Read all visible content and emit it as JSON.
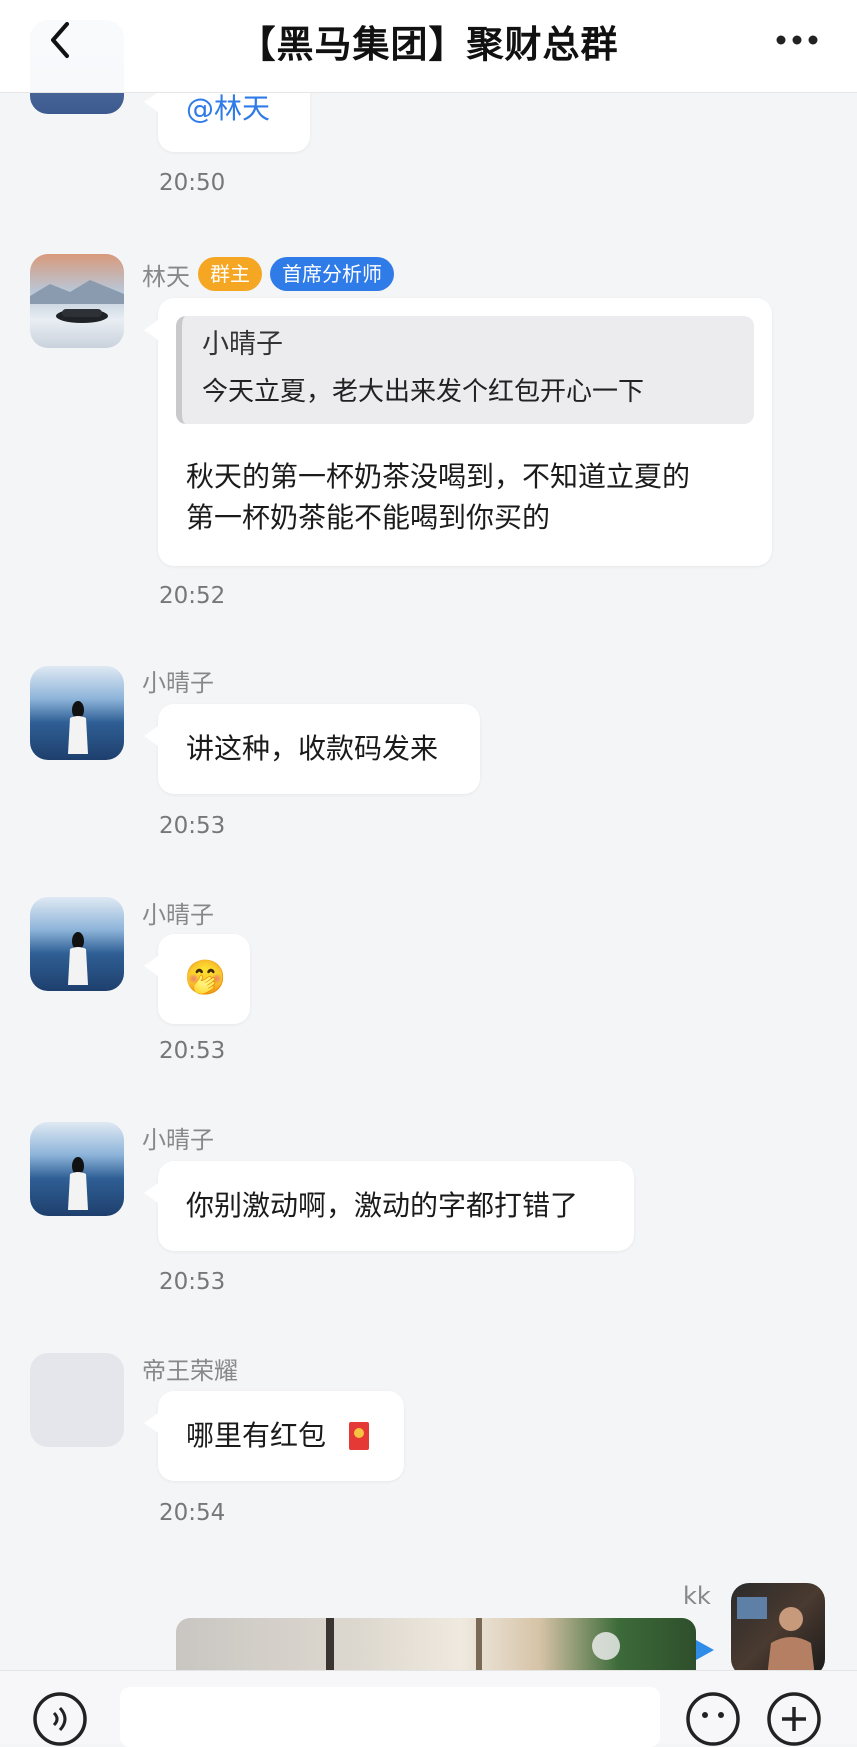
{
  "header": {
    "title": "【黑马集团】聚财总群"
  },
  "messages": [
    {
      "text": "@林天",
      "time": "20:50"
    },
    {
      "sender": "林天",
      "badges": {
        "owner": "群主",
        "title": "首席分析师"
      },
      "quote": {
        "author": "小晴子",
        "text": "今天立夏，老大出来发个红包开心一下"
      },
      "line1": "秋天的第一杯奶茶没喝到，不知道立夏的",
      "line2": "第一杯奶茶能不能喝到你买的",
      "time": "20:52"
    },
    {
      "sender": "小晴子",
      "text": "讲这种，收款码发来",
      "time": "20:53"
    },
    {
      "sender": "小晴子",
      "emoji": "🤭",
      "time": "20:53"
    },
    {
      "sender": "小晴子",
      "text": "你别激动啊，激动的字都打错了",
      "time": "20:53"
    },
    {
      "sender": "帝王荣耀",
      "text": "哪里有红包",
      "time": "20:54"
    },
    {
      "sender": "kk"
    }
  ],
  "colors": {
    "owner_badge": "#f5a623",
    "title_badge": "#2f7be8",
    "mention": "#2f7be8"
  },
  "icons": [
    "back-arrow-icon",
    "more-dots-icon",
    "red-packet-icon",
    "voice-icon",
    "emoji-icon",
    "plus-icon",
    "send-arrow-icon"
  ]
}
